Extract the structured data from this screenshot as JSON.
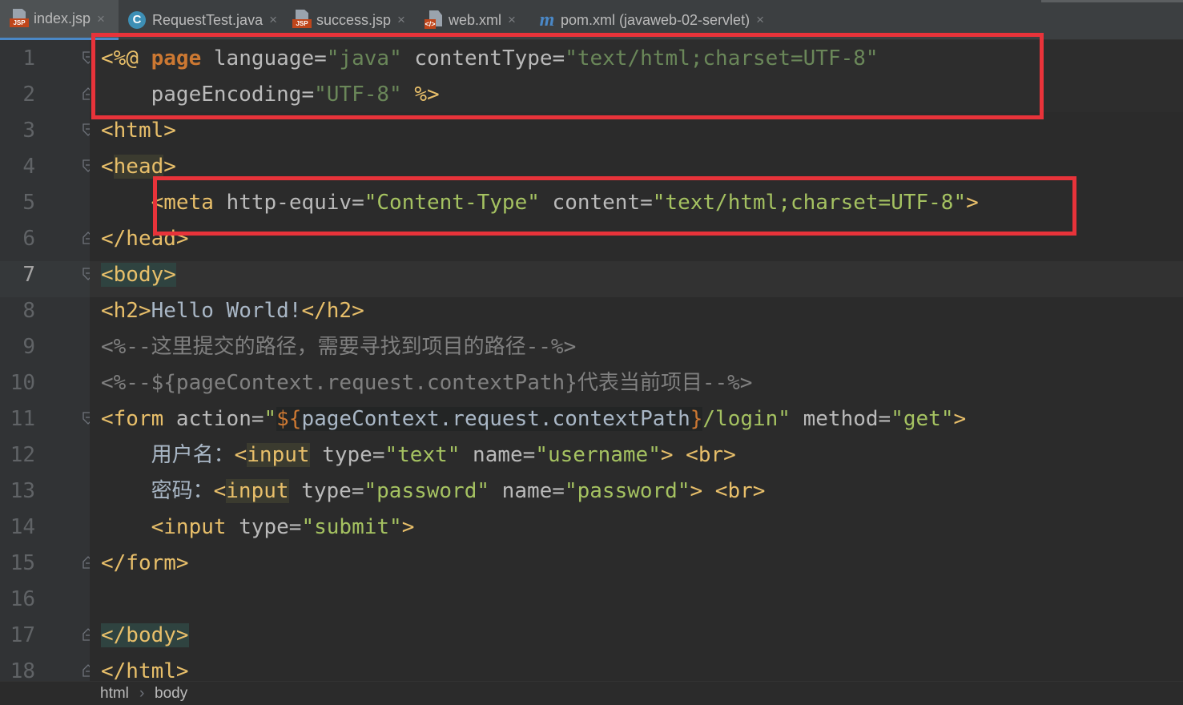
{
  "tabs": [
    {
      "label": "index.jsp",
      "icon": "jsp-file-icon",
      "active": true
    },
    {
      "label": "RequestTest.java",
      "icon": "java-class-icon",
      "active": false
    },
    {
      "label": "success.jsp",
      "icon": "jsp-file-icon",
      "active": false
    },
    {
      "label": "web.xml",
      "icon": "xml-file-icon",
      "active": false
    },
    {
      "label": "pom.xml (javaweb-02-servlet)",
      "icon": "maven-icon",
      "active": false
    }
  ],
  "close_glyph": "×",
  "jsp_badge": "JSP",
  "java_badge": "C",
  "xml_badge": "</>",
  "maven_badge": "m",
  "current_line": 7,
  "line_numbers": [
    "1",
    "2",
    "3",
    "4",
    "5",
    "6",
    "7",
    "8",
    "9",
    "10",
    "11",
    "12",
    "13",
    "14",
    "15",
    "16",
    "17",
    "18"
  ],
  "code": {
    "l1": {
      "a": "<%@ ",
      "b": "page",
      "c": " language=",
      "d": "\"java\"",
      "e": " contentType=",
      "f": "\"text/html;charset=UTF-8\""
    },
    "l2": {
      "a": "    pageEncoding=",
      "b": "\"UTF-8\"",
      "c": " %>"
    },
    "l3": {
      "a": "<html>"
    },
    "l4": {
      "a": "<",
      "b": "head",
      ">": ">",
      "c": ">"
    },
    "l5": {
      "a": "    <meta ",
      "b": "http-equiv=",
      "c": "\"Content-Type\"",
      "d": " content=",
      "e": "\"text/html;charset=UTF-8\"",
      "f": ">"
    },
    "l6": {
      "a": "</head>"
    },
    "l7": {
      "a": "<body>"
    },
    "l8": {
      "a": "<h2>",
      "b": "Hello World!",
      "c": "</h2>"
    },
    "l9": {
      "a": "<%--这里提交的路径，需要寻找到项目的路径--%>"
    },
    "l10": {
      "a": "<%--${pageContext.request.contextPath}代表当前项目--%>"
    },
    "l11": {
      "a": "<form ",
      "b": "action=",
      "c": "\"",
      "d": "${",
      "e": "pageContext.request.contextPath",
      "f": "}",
      "g": "/login\"",
      "h": " method=",
      "i": "\"get\"",
      "j": ">"
    },
    "l12": {
      "a": "    用户名：",
      "b": "<",
      "c": "input",
      "d": " type=",
      "e": "\"text\"",
      "f": " name=",
      "g": "\"username\"",
      "h": ">",
      "i": " <br>"
    },
    "l13": {
      "a": "    密码：",
      "b": "<",
      "c": "input",
      "d": " type=",
      "e": "\"password\"",
      "f": " name=",
      "g": "\"password\"",
      "h": ">",
      "i": " <br>"
    },
    "l14": {
      "a": "    <input ",
      "b": "type=",
      "c": "\"submit\"",
      "d": ">"
    },
    "l15": {
      "a": "</form>"
    },
    "l16": {
      "a": ""
    },
    "l17": {
      "a": "</body>"
    },
    "l18": {
      "a": "</html>"
    }
  },
  "breadcrumb": {
    "items": [
      "html",
      "body"
    ],
    "separator": "›"
  },
  "colors": {
    "annotation_box": "#e8333a",
    "tag": "#e8bf6a",
    "string": "#a5c261",
    "keyword": "#cc7832",
    "comment": "#808080"
  }
}
